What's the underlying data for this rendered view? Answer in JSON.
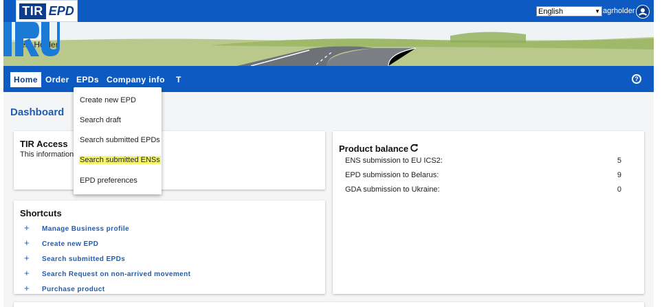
{
  "header": {
    "logo_tir": "TIR",
    "logo_epd": "EPD",
    "language": "English",
    "username": "agrholder"
  },
  "banner": {
    "holder_name": "Test Holder"
  },
  "nav": {
    "items": [
      "Home",
      "Order",
      "EPDs",
      "Company info",
      "T"
    ],
    "active": "Home"
  },
  "page": {
    "title": "Dashboard"
  },
  "tir_access": {
    "title": "TIR Access",
    "text": "This information is"
  },
  "product_balance": {
    "title": "Product balance",
    "rows": [
      {
        "label": "ENS submission to EU ICS2:",
        "value": "5"
      },
      {
        "label": "EPD submission to Belarus:",
        "value": "9"
      },
      {
        "label": "GDA submission to Ukraine:",
        "value": "0"
      }
    ]
  },
  "shortcuts": {
    "title": "Shortcuts",
    "items": [
      "Manage Business profile",
      "Create new EPD",
      "Search submitted EPDs",
      "Search Request on non-arrived movement",
      "Purchase product"
    ]
  },
  "epds_menu": {
    "items": [
      "Create new EPD",
      "Search draft",
      "Search submitted EPDs",
      "Search submitted ENSs",
      "EPD preferences"
    ],
    "highlighted": "Search submitted ENSs"
  },
  "colors": {
    "brand_blue": "#0d5bc2",
    "link_blue": "#1e5db3",
    "highlight": "#f5f56a"
  }
}
